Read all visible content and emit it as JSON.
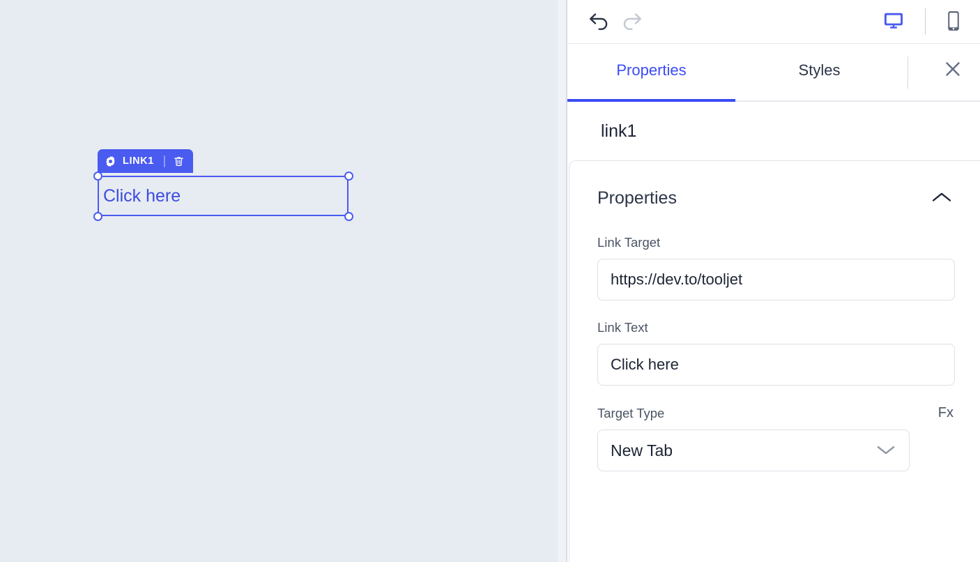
{
  "canvas": {
    "widget": {
      "badge_label": "LINK1",
      "gear_icon": "gear-icon",
      "trash_icon": "trash-icon",
      "link_text": "Click here"
    }
  },
  "inspector": {
    "toolbar": {
      "undo_icon": "undo-arrow-icon",
      "redo_icon": "redo-arrow-icon",
      "desktop_icon": "desktop-monitor-icon",
      "mobile_icon": "mobile-phone-icon"
    },
    "tabs": [
      {
        "label": "Properties",
        "active": true
      },
      {
        "label": "Styles",
        "active": false
      }
    ],
    "close_icon": "close-x-icon",
    "component_name": "link1",
    "section": {
      "title": "Properties",
      "collapse_icon": "chevron-up-icon"
    },
    "fields": {
      "link_target": {
        "label": "Link Target",
        "value": "https://dev.to/tooljet"
      },
      "link_text": {
        "label": "Link Text",
        "value": "Click here"
      },
      "target_type": {
        "label": "Target Type",
        "fx_label": "Fx",
        "value": "New Tab",
        "chevron_icon": "chevron-down-icon"
      }
    }
  },
  "colors": {
    "accent_blue": "#4a5bf0",
    "tab_blue": "#3b4cf5",
    "canvas_bg": "#e7ebf2",
    "panel_bg": "#ffffff",
    "muted_text": "#4a5364",
    "icon_gray": "#667087"
  }
}
